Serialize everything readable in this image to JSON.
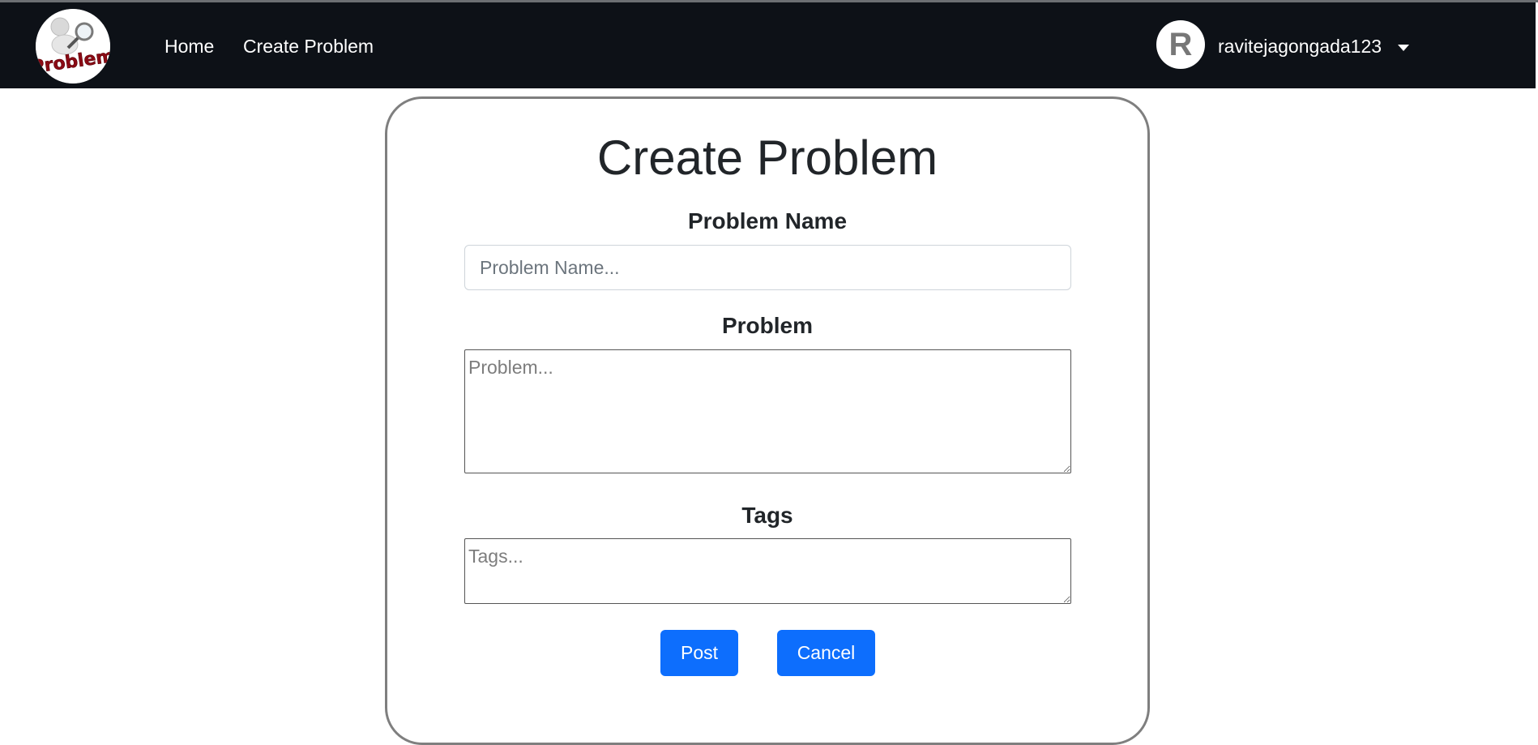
{
  "nav": {
    "logo_text": "Problem",
    "links": [
      {
        "label": "Home"
      },
      {
        "label": "Create Problem"
      }
    ],
    "user": {
      "avatar_letter": "R",
      "username": "ravitejagongada123"
    }
  },
  "form": {
    "title": "Create Problem",
    "problem_name": {
      "label": "Problem Name",
      "placeholder": "Problem Name...",
      "value": ""
    },
    "problem": {
      "label": "Problem",
      "placeholder": "Problem...",
      "value": ""
    },
    "tags": {
      "label": "Tags",
      "placeholder": "Tags...",
      "value": ""
    },
    "buttons": {
      "post": "Post",
      "cancel": "Cancel"
    }
  },
  "colors": {
    "navbar": "#0d1117",
    "primary": "#0d6efd",
    "card_border": "#7f7f7f",
    "logo_text": "#8b0a14"
  }
}
